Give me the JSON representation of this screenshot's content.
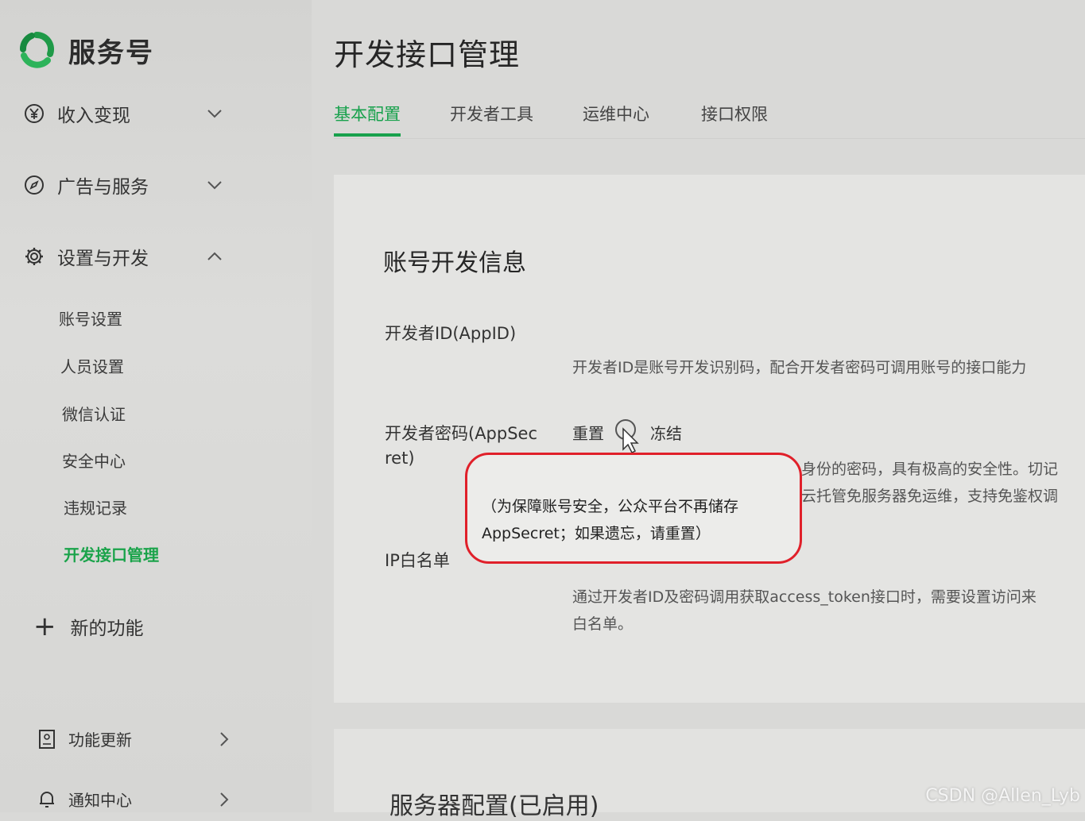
{
  "brand": {
    "name": "服务号"
  },
  "sidebar": {
    "groups": [
      {
        "label": "收入变现",
        "icon": "yen-circle-icon",
        "expanded": false
      },
      {
        "label": "广告与服务",
        "icon": "compass-icon",
        "expanded": false
      },
      {
        "label": "设置与开发",
        "icon": "gear-icon",
        "expanded": true
      }
    ],
    "sub_items": [
      "账号设置",
      "人员设置",
      "微信认证",
      "安全中心",
      "违规记录",
      "开发接口管理"
    ],
    "active_sub": "开发接口管理",
    "new_func": "新的功能",
    "bottom": [
      {
        "label": "功能更新",
        "icon": "document-icon"
      },
      {
        "label": "通知中心",
        "icon": "bell-icon"
      }
    ]
  },
  "main": {
    "title": "开发接口管理",
    "tabs": [
      "基本配置",
      "开发者工具",
      "运维中心",
      "接口权限"
    ],
    "active_tab": "基本配置",
    "section_title": "账号开发信息",
    "appid_label": "开发者ID(AppID)",
    "appid_desc": "开发者ID是账号开发识别码，配合开发者密码可调用账号的接口能力",
    "secret_label_line1": "开发者密码(AppSec",
    "secret_label_line2": "ret)",
    "reset": "重置",
    "freeze": "冻结",
    "secret_desc_line1": "身份的密码，具有极高的安全性。切记",
    "secret_desc_line2": "云托管免服务器免运维，支持免鉴权调",
    "callout_line1": "（为保障账号安全，公众平台不再储存",
    "callout_line2": "AppSecret；如果遗忘，请重置）",
    "ip_label": "IP白名单",
    "ip_desc_line1": "通过开发者ID及密码调用获取access_token接口时，需要设置访问来",
    "ip_desc_line2": "白名单。",
    "section2_title": "服务器配置(已启用)"
  },
  "watermark": "CSDN @Allen_Lyb",
  "colors": {
    "accent": "#18a14c",
    "highlight": "#e0202a"
  }
}
